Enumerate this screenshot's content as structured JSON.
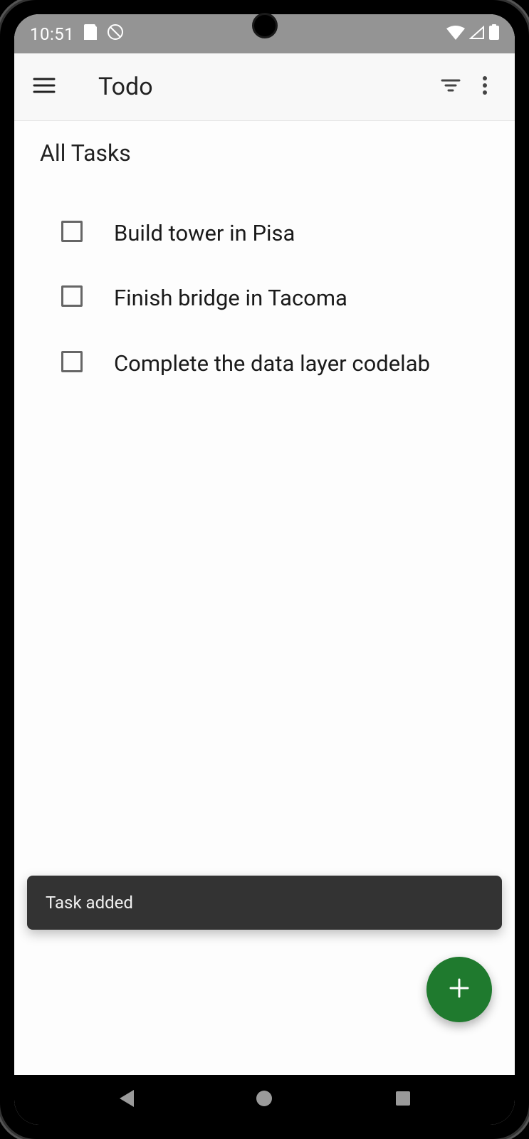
{
  "status_bar": {
    "time": "10:51"
  },
  "app_bar": {
    "title": "Todo"
  },
  "section": {
    "title": "All Tasks"
  },
  "tasks": [
    {
      "label": "Build tower in Pisa",
      "checked": false
    },
    {
      "label": "Finish bridge in Tacoma",
      "checked": false
    },
    {
      "label": "Complete the data layer codelab",
      "checked": false
    }
  ],
  "snackbar": {
    "message": "Task added"
  },
  "colors": {
    "fab": "#1f7a2e",
    "snackbar_bg": "#333333",
    "status_bg": "#949494"
  }
}
